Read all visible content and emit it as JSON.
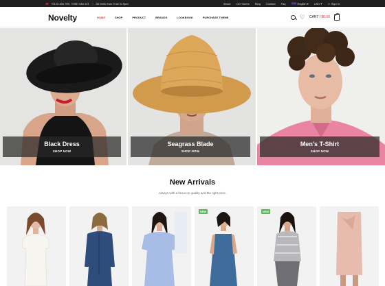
{
  "topbar": {
    "phones": "+0123 456 789, +0987 654 321",
    "hours": "All week from 9 am to 9pm",
    "links": [
      "About",
      "Our Stores",
      "Blog",
      "Contact",
      "Faq"
    ],
    "language": "English",
    "currency": "USD",
    "signin": "Sign In"
  },
  "header": {
    "logo": "Novelty",
    "nav": [
      "HOME",
      "SHOP",
      "PRODUCT",
      "BRANDS",
      "LOOKBOOK",
      "PURCHASE THEME"
    ],
    "active_nav": "HOME",
    "cart_label": "CART /",
    "cart_amount": "$0.00"
  },
  "banners": [
    {
      "title": "Black Dress",
      "cta": "SHOP NOW"
    },
    {
      "title": "Seagrass Blade",
      "cta": "SHOP NOW"
    },
    {
      "title": "Men's T-Shirt",
      "cta": "SHOP NOW"
    }
  ],
  "new_arrivals": {
    "title": "New Arrivals",
    "subtitle": "Always with a focus on quality and the right price.",
    "badge": "NEW",
    "products": [
      {
        "badge": false
      },
      {
        "badge": false
      },
      {
        "badge": false
      },
      {
        "badge": true
      },
      {
        "badge": true
      },
      {
        "badge": false
      }
    ]
  },
  "colors": {
    "accent": "#e53935",
    "topbar_bg": "#1f1f1f",
    "badge_new": "#5cb85c"
  }
}
